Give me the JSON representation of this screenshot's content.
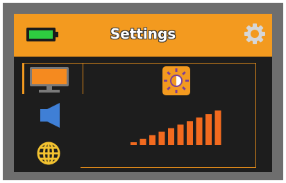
{
  "header": {
    "title": "Settings",
    "battery_icon": "battery-full-icon",
    "settings_icon": "gear-icon",
    "battery_level": 1.0
  },
  "tabs": [
    {
      "name": "display",
      "icon": "monitor-icon",
      "active": true
    },
    {
      "name": "sound",
      "icon": "speaker-icon",
      "active": false
    },
    {
      "name": "language",
      "icon": "globe-icon",
      "active": false
    }
  ],
  "content": {
    "setting_icon": "brightness-icon",
    "brightness_level": 10,
    "brightness_max": 10
  },
  "colors": {
    "accent": "#f39a1f",
    "background": "#1d1d1d",
    "bars": "#f26a1f",
    "battery": "#2ecc40",
    "speaker": "#3f7fd6",
    "globe": "#f2c230"
  }
}
